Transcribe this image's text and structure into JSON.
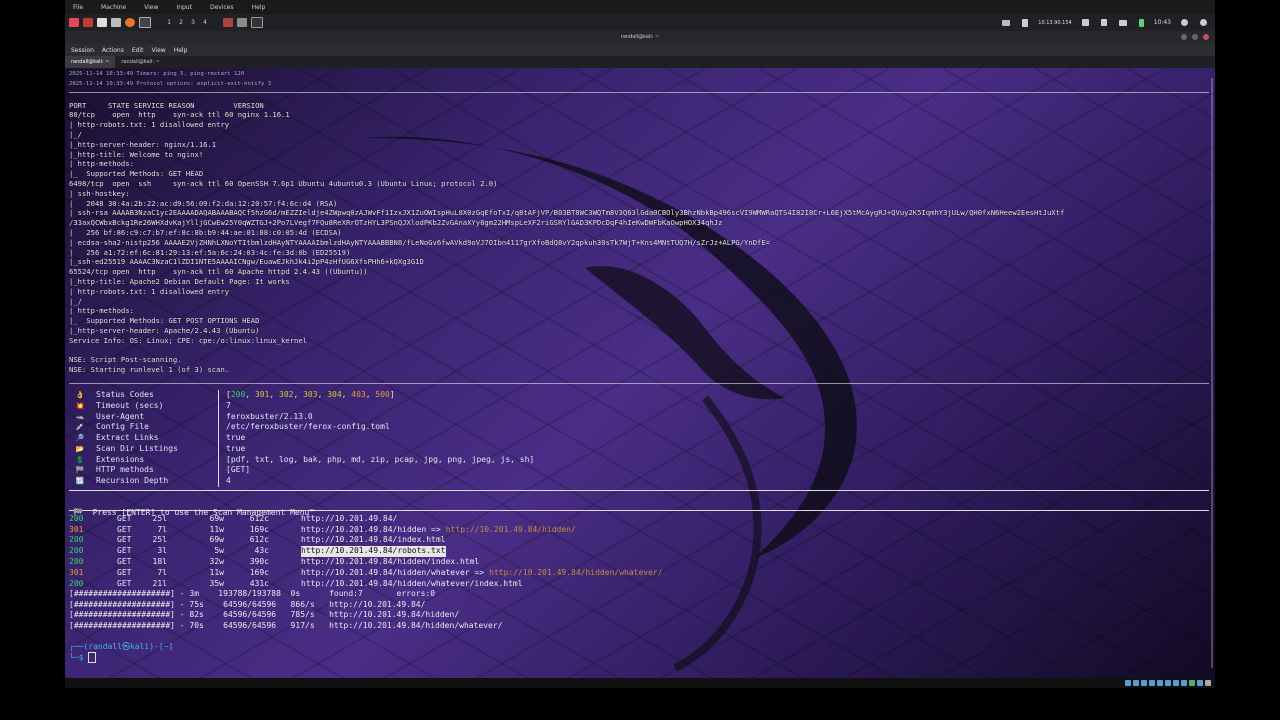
{
  "vm": {
    "menu": [
      "File",
      "Machine",
      "View",
      "Input",
      "Devices",
      "Help"
    ],
    "workspaces": [
      "1",
      "2",
      "3",
      "4"
    ],
    "tray": {
      "ip": "10.13.90.154",
      "time": "10:43"
    }
  },
  "window": {
    "title": "randall@kali: ~"
  },
  "term_menu": [
    "Session",
    "Actions",
    "Edit",
    "View",
    "Help"
  ],
  "tabs": [
    "randall@kali: ~",
    "randall@kali: ~"
  ],
  "nmap": {
    "header1": "2025-11-14 10:33:49 Timers: ping 5, ping-restart 120",
    "header2": "2025-11-14 10:33:49 Protocol options: explicit-exit-notify 3",
    "lines": [
      "PORT     STATE SERVICE REASON         VERSION",
      "80/tcp    open  http    syn-ack ttl 60 nginx 1.16.1",
      "| http-robots.txt: 1 disallowed entry",
      "|_/",
      "|_http-server-header: nginx/1.16.1",
      "|_http-title: Welcome to nginx!",
      "| http-methods:",
      "|_  Supported Methods: GET HEAD",
      "6498/tcp  open  ssh     syn-ack ttl 60 OpenSSH 7.6p1 Ubuntu 4ubuntu0.3 (Ubuntu Linux; protocol 2.0)",
      "| ssh-hostkey:",
      "|   2048 30:4a:2b:22:ac:d9:56:09:f2:da:12:20:57:f4:6c:d4 (RSA)",
      "| ssh-rsa AAAAB3NzaC1yc2EAAAADAQABAAABAQCf5hzG6d/mEZZIeldje4ZWpwq0zAJWvFf1IzxJX1ZuOWIspHuL0X0zGqEfoTxI/q8tAFjVP/B03BT8WC3WQTm8V3Q63lGda0CBOly3BhzNbkBp496scVI9WMWRaQTS4I82I8Cr+L6EjX5tMcAygRJ+QVuy2K5IqmhY3jULw/QH0fxN6Heew2EesHtJuXtf",
      "/33axQCWbxBckg1Re26WHXdvKajYlljGCwEw25Y0qWZTGJ+2Po7LVegf7FQu8ReXRrOTzHYL3PSnQJXlodPKb2ZvGAnaXYy8gm22HMspLeXF2riGSRYlGAD3KPDcDqF4hIeKwDWFbKaOwpHOX34qhJz",
      "|   256 bf:86:c9:c7:b7:ef:8c:8b:b9:44:ae:01:88:c0:05:4d (ECDSA)",
      "| ecdsa-sha2-nistp256 AAAAE2VjZHNhLXNoYTItbmlzdHAyNTYAAAAIbmlzdHAyNTYAAABBBN8/fLeNoGv6fwAVkd9oVJ7OIbn4117grXfoBdQ8vY2qpkuh30sTk7WjT+Kns4MNtTUQ7H/sZrJz+ALPG/YnDfE=",
      "|   256 a1:72:ef:6c:81:29:13:ef:5a:6c:24:03:4c:fe:3d:0b (ED25519)",
      "|_ssh-ed25519 AAAAC3NzaC1lZDI1NTE5AAAAICNgw/EuawEJkhJk4i2pP4zHfUG6XfsPHh6+kQXg3G1D",
      "65524/tcp open  http    syn-ack ttl 60 Apache httpd 2.4.43 ((Ubuntu))",
      "|_http-title: Apache2 Debian Default Page: It works",
      "| http-robots.txt: 1 disallowed entry",
      "|_/",
      "| http-methods:",
      "|_  Supported Methods: GET POST OPTIONS HEAD",
      "|_http-server-header: Apache/2.4.43 (Ubuntu)",
      "Service Info: OS: Linux; CPE: cpe:/o:linux:linux_kernel",
      "",
      "NSE: Script Post-scanning.",
      "NSE: Starting runlevel 1 (of 3) scan."
    ]
  },
  "ferox": {
    "config": [
      {
        "icon": "👌",
        "key": "Status Codes",
        "value": "[200, 301, 302, 303, 304, 403, 500]"
      },
      {
        "icon": "💥",
        "key": "Timeout (secs)",
        "value": "7"
      },
      {
        "icon": "🦡",
        "key": "User-Agent",
        "value": "feroxbuster/2.13.0"
      },
      {
        "icon": "💉",
        "key": "Config File",
        "value": "/etc/feroxbuster/ferox-config.toml"
      },
      {
        "icon": "🔎",
        "key": "Extract Links",
        "value": "true"
      },
      {
        "icon": "📂",
        "key": "Scan Dir Listings",
        "value": "true"
      },
      {
        "icon": "💲",
        "key": "Extensions",
        "value": "[pdf, txt, log, bak, php, md, zip, pcap, jpg, png, jpeg, js, sh]"
      },
      {
        "icon": "🏁",
        "key": "HTTP methods",
        "value": "[GET]"
      },
      {
        "icon": "🔃",
        "key": "Recursion Depth",
        "value": "4"
      }
    ],
    "menu_hint": "🏁  Press [ENTER] to use the Scan Management Menu™",
    "results": [
      {
        "code": "200",
        "method": "GET",
        "lines": "25l",
        "words": "69w",
        "chars": "612c",
        "url": "http://10.201.49.84/",
        "redirect": ""
      },
      {
        "code": "301",
        "method": "GET",
        "lines": "7l",
        "words": "11w",
        "chars": "169c",
        "url": "http://10.201.49.84/hidden =>",
        "redirect": "http://10.201.49.84/hidden/"
      },
      {
        "code": "200",
        "method": "GET",
        "lines": "25l",
        "words": "69w",
        "chars": "612c",
        "url": "http://10.201.49.84/index.html",
        "redirect": ""
      },
      {
        "code": "200",
        "method": "GET",
        "lines": "3l",
        "words": "5w",
        "chars": "43c",
        "url": "http://10.201.49.84/robots.txt",
        "redirect": "",
        "highlight": true
      },
      {
        "code": "200",
        "method": "GET",
        "lines": "18l",
        "words": "32w",
        "chars": "390c",
        "url": "http://10.201.49.84/hidden/index.html",
        "redirect": ""
      },
      {
        "code": "301",
        "method": "GET",
        "lines": "7l",
        "words": "11w",
        "chars": "169c",
        "url": "http://10.201.49.84/hidden/whatever =>",
        "redirect": "http://10.201.49.84/hidden/whatever/"
      },
      {
        "code": "200",
        "method": "GET",
        "lines": "21l",
        "words": "35w",
        "chars": "431c",
        "url": "http://10.201.49.84/hidden/whatever/index.html",
        "redirect": ""
      }
    ],
    "progress": [
      "[####################] - 3m    193788/193788  0s      found:7       errors:0",
      "[####################] - 75s    64596/64596   866/s   http://10.201.49.84/",
      "[####################] - 82s    64596/64596   785/s   http://10.201.49.84/hidden/",
      "[####################] - 70s    64596/64596   917/s   http://10.201.49.84/hidden/whatever/"
    ]
  },
  "prompt": {
    "line1": "┌──(randall㉿kali)-[~]",
    "line2": "└─$ "
  },
  "colors": {
    "ok": "#33d36a",
    "redirect": "#e0a12c",
    "prompt": "#3fb5e8"
  }
}
